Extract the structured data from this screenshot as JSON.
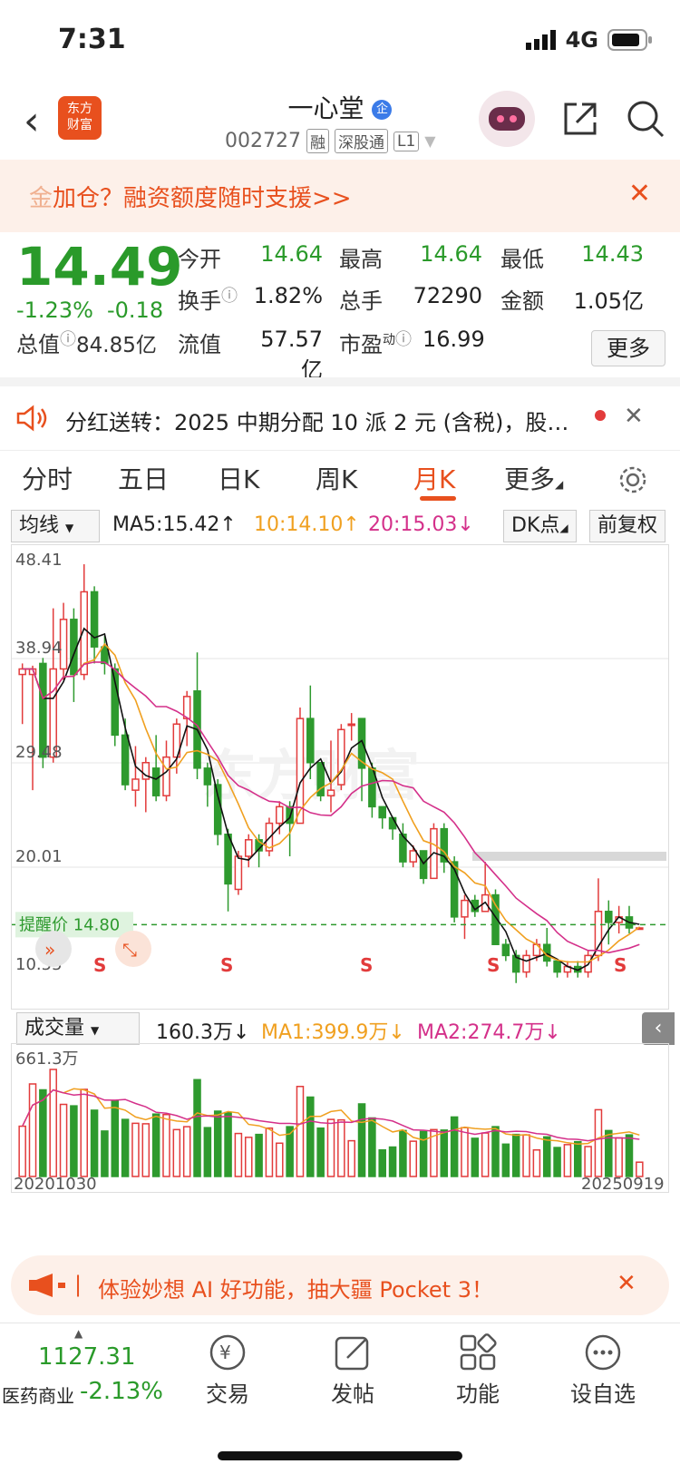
{
  "status": {
    "time": "7:31",
    "network": "4G"
  },
  "header": {
    "logo_line1": "东方",
    "logo_line2": "财富",
    "name": "一心堂",
    "name_badge": "企",
    "code": "002727",
    "tags": [
      "融",
      "深股通",
      "L1"
    ]
  },
  "banner": {
    "prefix": "金",
    "text": "加仓？融资额度随时支援>>",
    "close": "✕"
  },
  "quote": {
    "price": "14.49",
    "change_pct": "-1.23%",
    "change_amt": "-0.18",
    "open_label": "今开",
    "open": "14.64",
    "high_label": "最高",
    "high": "14.64",
    "low_label": "最低",
    "low": "14.43",
    "turnover_label": "换手",
    "turnover": "1.82%",
    "volume_label": "总手",
    "volume": "72290",
    "amount_label": "金额",
    "amount": "1.05亿",
    "mktcap_label": "总值",
    "mktcap": "84.85亿",
    "float_label": "流值",
    "float_cap": "57.57亿",
    "pe_label": "市盈",
    "pe_sup": "动",
    "pe": "16.99",
    "more": "更多"
  },
  "dividend": {
    "text": "分红送转：2025 中期分配 10 派 2 元 (含税)，股…",
    "close": "✕"
  },
  "tabs": [
    "分时",
    "五日",
    "日K",
    "周K",
    "月K",
    "更多"
  ],
  "active_tab": "月K",
  "toolbar": {
    "indicator": "均线",
    "ma5": "MA5:15.42↑",
    "ma10": "10:14.10↑",
    "ma20": "20:15.03↓",
    "dk": "DK点",
    "adjust": "前复权"
  },
  "colors": {
    "up": "#e23b3b",
    "down": "#2e9a2e",
    "ma5": "#111111",
    "ma10": "#f0a020",
    "ma20": "#d4308a",
    "accent": "#e8501e"
  },
  "chart_data": [
    {
      "type": "candlestick",
      "title": "月K",
      "y_ticks": [
        "48.41",
        "38.94",
        "29.48",
        "20.01",
        "10.55"
      ],
      "ylim": [
        10.55,
        48.41
      ],
      "alert_label": "提醒价 14.80",
      "alert_value": 14.8,
      "signal_label": "S",
      "candles": [
        [
          37.5,
          38.0,
          33.0,
          38.5
        ],
        [
          37.5,
          38.0,
          27.0,
          38.3
        ],
        [
          38.5,
          30.0,
          29.0,
          39.0
        ],
        [
          30.0,
          38.0,
          29.5,
          43.5
        ],
        [
          38.0,
          42.5,
          37.0,
          44.0
        ],
        [
          42.5,
          37.5,
          35.0,
          43.5
        ],
        [
          37.5,
          45.0,
          37.0,
          47.5
        ],
        [
          45.0,
          40.0,
          38.5,
          45.5
        ],
        [
          40.0,
          38.5,
          37.5,
          41.0
        ],
        [
          38.0,
          32.0,
          31.0,
          38.5
        ],
        [
          32.0,
          27.5,
          27.0,
          33.5
        ],
        [
          27.0,
          28.0,
          25.5,
          31.0
        ],
        [
          28.0,
          29.5,
          25.0,
          30.0
        ],
        [
          29.0,
          26.5,
          26.0,
          32.0
        ],
        [
          26.5,
          30.0,
          26.0,
          31.5
        ],
        [
          30.0,
          33.0,
          28.5,
          33.5
        ],
        [
          33.5,
          35.5,
          31.0,
          36.0
        ],
        [
          36.0,
          29.0,
          28.0,
          39.5
        ],
        [
          29.0,
          27.5,
          25.5,
          29.5
        ],
        [
          27.5,
          23.0,
          22.0,
          28.0
        ],
        [
          23.0,
          18.5,
          16.0,
          23.5
        ],
        [
          18.0,
          21.0,
          17.5,
          21.5
        ],
        [
          21.0,
          22.5,
          20.0,
          23.0
        ],
        [
          22.5,
          21.5,
          20.0,
          23.0
        ],
        [
          21.5,
          24.0,
          21.0,
          24.5
        ],
        [
          24.0,
          25.5,
          23.0,
          26.0
        ],
        [
          25.5,
          24.0,
          21.0,
          26.0
        ],
        [
          24.0,
          33.5,
          24.0,
          34.5
        ],
        [
          33.5,
          29.5,
          28.0,
          36.5
        ],
        [
          29.5,
          26.5,
          26.0,
          29.5
        ],
        [
          26.5,
          27.0,
          25.0,
          31.5
        ],
        [
          27.5,
          32.5,
          27.0,
          33.0
        ],
        [
          33.0,
          33.0,
          31.5,
          34.0
        ],
        [
          33.5,
          29.0,
          26.0,
          33.5
        ],
        [
          29.0,
          25.5,
          24.5,
          29.5
        ],
        [
          25.5,
          24.5,
          23.5,
          25.5
        ],
        [
          24.5,
          23.5,
          22.5,
          24.5
        ],
        [
          23.0,
          20.5,
          20.0,
          24.0
        ],
        [
          20.5,
          21.5,
          20.0,
          22.0
        ],
        [
          21.5,
          19.0,
          18.5,
          21.5
        ],
        [
          19.0,
          23.5,
          19.0,
          24.0
        ],
        [
          23.5,
          20.5,
          19.5,
          24.0
        ],
        [
          20.5,
          15.5,
          15.0,
          21.0
        ],
        [
          15.5,
          17.0,
          13.5,
          17.5
        ],
        [
          17.0,
          16.0,
          15.5,
          17.5
        ],
        [
          16.0,
          17.5,
          16.0,
          20.5
        ],
        [
          17.5,
          13.0,
          13.0,
          18.0
        ],
        [
          13.0,
          12.0,
          11.5,
          13.5
        ],
        [
          12.0,
          10.5,
          9.5,
          12.5
        ],
        [
          10.5,
          12.0,
          10.0,
          12.5
        ],
        [
          12.0,
          13.0,
          11.5,
          13.5
        ],
        [
          13.0,
          11.5,
          11.0,
          14.5
        ],
        [
          11.5,
          10.5,
          10.0,
          11.5
        ],
        [
          10.5,
          11.0,
          10.0,
          11.5
        ],
        [
          11.0,
          10.5,
          10.0,
          11.5
        ],
        [
          10.5,
          12.0,
          10.0,
          12.5
        ],
        [
          12.0,
          16.0,
          11.5,
          19.0
        ],
        [
          16.0,
          15.0,
          13.0,
          17.0
        ],
        [
          15.0,
          15.5,
          14.0,
          16.5
        ],
        [
          15.5,
          14.5,
          14.0,
          16.5
        ],
        [
          14.5,
          14.5,
          14.4,
          14.6
        ]
      ]
    },
    {
      "type": "bar",
      "title": "成交量",
      "indicator": "成交量",
      "vol": "160.3万↓",
      "ma1": "MA1:399.9万↓",
      "ma2": "MA2:274.7万↓",
      "y_max_label": "661.3万",
      "ylim": [
        0,
        661.3
      ],
      "x_start": "20201030",
      "x_end": "20250919"
    }
  ],
  "promo": {
    "text": "体验妙想 AI 好功能，抽大疆 Pocket 3！",
    "close": "✕"
  },
  "bottom": {
    "index_value": "1127.31",
    "index_name": "医药商业",
    "index_change": "-2.13%",
    "nav": [
      "交易",
      "发帖",
      "功能",
      "设自选"
    ]
  }
}
